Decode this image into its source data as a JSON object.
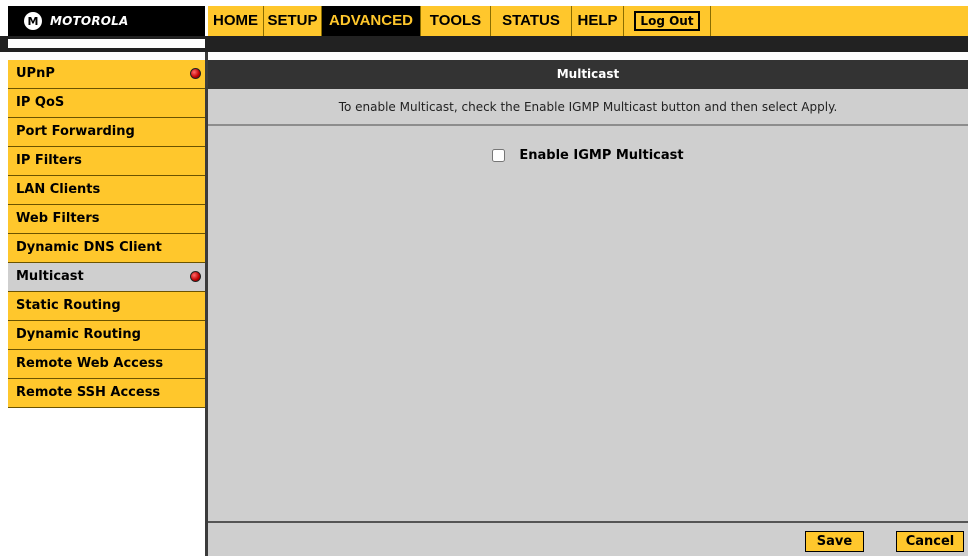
{
  "brand": {
    "logo_mark": "M",
    "logo_text": "MOTOROLA"
  },
  "topnav": {
    "tabs": [
      {
        "label": "HOME"
      },
      {
        "label": "SETUP"
      },
      {
        "label": "ADVANCED",
        "active": true
      },
      {
        "label": "TOOLS"
      },
      {
        "label": "STATUS"
      },
      {
        "label": "HELP"
      }
    ],
    "logout_label": "Log Out"
  },
  "sidebar": {
    "items": [
      {
        "label": "UPnP",
        "indicator": true
      },
      {
        "label": "IP QoS"
      },
      {
        "label": "Port Forwarding"
      },
      {
        "label": "IP Filters"
      },
      {
        "label": "LAN Clients"
      },
      {
        "label": "Web Filters"
      },
      {
        "label": "Dynamic DNS Client"
      },
      {
        "label": "Multicast",
        "active": true,
        "indicator": true
      },
      {
        "label": "Static Routing"
      },
      {
        "label": "Dynamic Routing"
      },
      {
        "label": "Remote Web Access"
      },
      {
        "label": "Remote SSH Access"
      }
    ]
  },
  "main": {
    "title": "Multicast",
    "instructions": "To enable Multicast, check the Enable IGMP Multicast button and then select Apply.",
    "igmp_label": "Enable IGMP Multicast",
    "igmp_checked": false
  },
  "footer": {
    "save_label": "Save",
    "cancel_label": "Cancel"
  },
  "colors": {
    "accent": "#ffc72c",
    "dark": "#333333",
    "panel": "#cfcfcf",
    "indicator": "#c00000"
  }
}
